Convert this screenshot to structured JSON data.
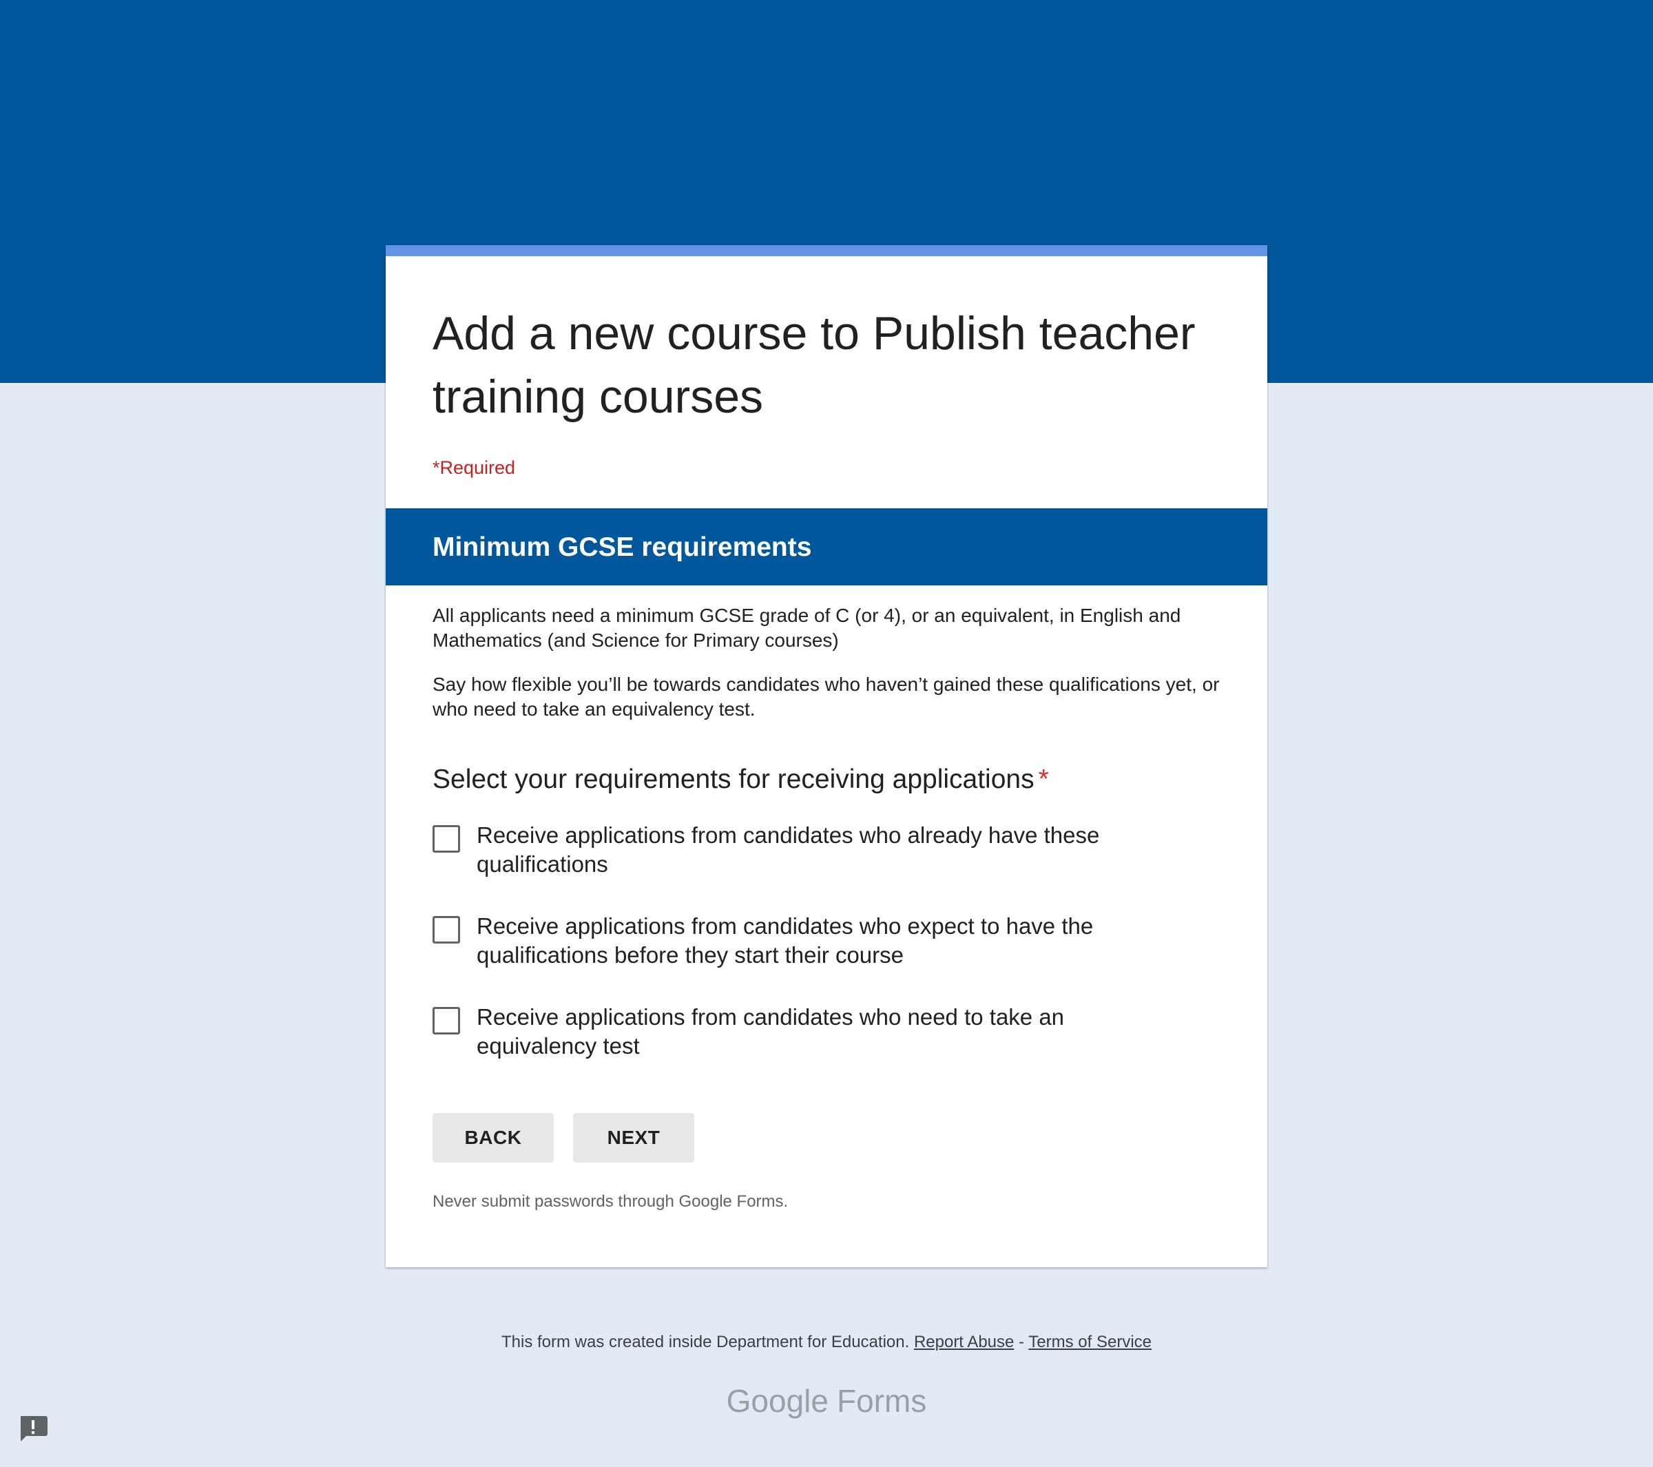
{
  "form": {
    "title": "Add a new course to Publish teacher training courses",
    "required_note": "*Required",
    "accent_color": "#01579b",
    "card_accent_color": "#6493e6"
  },
  "section": {
    "title": "Minimum GCSE requirements",
    "description_1": "All applicants need a minimum GCSE grade of C (or 4), or an equivalent, in English and Mathematics (and Science for Primary courses)",
    "description_2": "Say how flexible you’ll be towards candidates who haven’t gained these qualifications yet, or who need to take an equivalency test."
  },
  "question": {
    "text": "Select your requirements for receiving applications",
    "required_mark": "*",
    "options": [
      {
        "label": "Receive applications from candidates who already have these qualifications",
        "checked": false
      },
      {
        "label": "Receive applications from candidates who expect to have the qualifications before they start their course",
        "checked": false
      },
      {
        "label": "Receive applications from candidates who need to take an equivalency test",
        "checked": false
      }
    ]
  },
  "buttons": {
    "back": "BACK",
    "next": "NEXT"
  },
  "password_note": "Never submit passwords through Google Forms.",
  "footer": {
    "created_text": "This form was created inside Department for Education.",
    "report_abuse": "Report Abuse",
    "separator": "-",
    "terms": "Terms of Service"
  },
  "brand": {
    "google": "Google",
    "forms": "Forms"
  },
  "icons": {
    "feedback": "report-feedback-icon"
  }
}
